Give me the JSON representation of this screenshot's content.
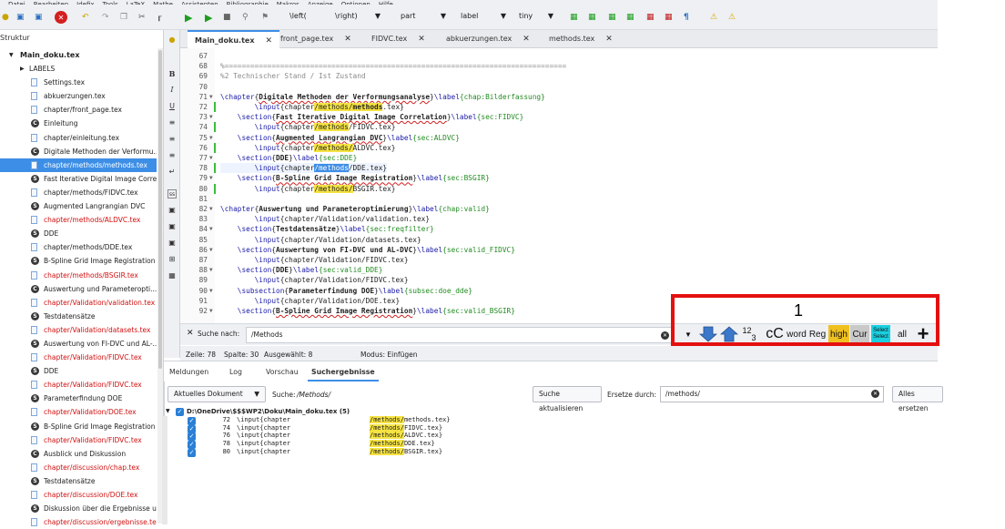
{
  "menu": [
    "Datei",
    "Bearbeiten",
    "Idefix",
    "Tools",
    "LaTeX",
    "Mathe",
    "Assistenten",
    "Bibliographie",
    "Makros",
    "Anzeige",
    "Optionen",
    "Hilfe"
  ],
  "toolbar": {
    "left_delim": "\\left(",
    "right_delim": "\\right)",
    "part": "part",
    "label": "label",
    "size": "tiny"
  },
  "sidebar": {
    "header": "Struktur",
    "items": [
      {
        "label": "Main_doku.tex",
        "type": "root",
        "depth": 0
      },
      {
        "label": "LABELS",
        "type": "folder",
        "depth": 1
      },
      {
        "label": "Settings.tex",
        "type": "file",
        "depth": 2
      },
      {
        "label": "abkuerzungen.tex",
        "type": "file",
        "depth": 2
      },
      {
        "label": "chapter/front_page.tex",
        "type": "file",
        "depth": 2
      },
      {
        "label": "Einleitung",
        "type": "chapter",
        "depth": 2
      },
      {
        "label": "chapter/einleitung.tex",
        "type": "file",
        "depth": 2
      },
      {
        "label": "Digitale Methoden der Verformu...",
        "type": "chapter",
        "depth": 2
      },
      {
        "label": "chapter/methods/methods.tex",
        "type": "file",
        "depth": 2,
        "selected": true
      },
      {
        "label": "Fast Iterative Digital Image Corre...",
        "type": "section",
        "depth": 2
      },
      {
        "label": "chapter/methods/FIDVC.tex",
        "type": "file",
        "depth": 2
      },
      {
        "label": "Augmented Langrangian DVC",
        "type": "section",
        "depth": 2
      },
      {
        "label": "chapter/methods/ALDVC.tex",
        "type": "file",
        "depth": 2,
        "red": true
      },
      {
        "label": "DDE",
        "type": "section",
        "depth": 2,
        "current": true
      },
      {
        "label": "chapter/methods/DDE.tex",
        "type": "file",
        "depth": 2
      },
      {
        "label": "B-Spline Grid Image Registration",
        "type": "section",
        "depth": 2
      },
      {
        "label": "chapter/methods/BSGIR.tex",
        "type": "file",
        "depth": 2,
        "red": true
      },
      {
        "label": "Auswertung und Parameteropti...",
        "type": "chapter",
        "depth": 2
      },
      {
        "label": "chapter/Validation/validation.tex",
        "type": "file",
        "depth": 2,
        "red": true
      },
      {
        "label": "Testdatensätze",
        "type": "section",
        "depth": 2
      },
      {
        "label": "chapter/Validation/datasets.tex",
        "type": "file",
        "depth": 2,
        "red": true
      },
      {
        "label": "Auswertung von FI-DVC und AL-...",
        "type": "section",
        "depth": 2
      },
      {
        "label": "chapter/Validation/FIDVC.tex",
        "type": "file",
        "depth": 2,
        "red": true
      },
      {
        "label": "DDE",
        "type": "section",
        "depth": 2
      },
      {
        "label": "chapter/Validation/FIDVC.tex",
        "type": "file",
        "depth": 2,
        "red": true
      },
      {
        "label": "Parameterfindung DOE",
        "type": "section",
        "depth": 2
      },
      {
        "label": "chapter/Validation/DOE.tex",
        "type": "file",
        "depth": 2,
        "red": true
      },
      {
        "label": "B-Spline Grid Image Registration",
        "type": "section",
        "depth": 2
      },
      {
        "label": "chapter/Validation/FIDVC.tex",
        "type": "file",
        "depth": 2,
        "red": true
      },
      {
        "label": "Ausblick und Diskussion",
        "type": "chapter",
        "depth": 2
      },
      {
        "label": "chapter/discussion/chap.tex",
        "type": "file",
        "depth": 2,
        "red": true
      },
      {
        "label": "Testdatensätze",
        "type": "section",
        "depth": 2
      },
      {
        "label": "chapter/discussion/DOE.tex",
        "type": "file",
        "depth": 2,
        "red": true
      },
      {
        "label": "Diskussion über die Ergebnisse u...",
        "type": "section",
        "depth": 2
      },
      {
        "label": "chapter/discussion/ergebnisse.tex",
        "type": "file",
        "depth": 2,
        "red": true
      }
    ]
  },
  "tabs": [
    {
      "label": "Main_doku.tex",
      "active": true
    },
    {
      "label": "front_page.tex"
    },
    {
      "label": "FIDVC.tex"
    },
    {
      "label": "abkuerzungen.tex"
    },
    {
      "label": "methods.tex"
    }
  ],
  "editor": {
    "lines": [
      {
        "n": "67",
        "segs": []
      },
      {
        "n": "68",
        "segs": [
          {
            "t": "%================================================================================",
            "c": "cmt"
          }
        ]
      },
      {
        "n": "69",
        "segs": [
          {
            "t": "%2 Technischer Stand / Ist Zustand",
            "c": "cmt"
          }
        ]
      },
      {
        "n": "70",
        "segs": []
      },
      {
        "n": "71",
        "fold": true,
        "segs": [
          {
            "t": "\\chapter",
            "c": "cmd"
          },
          {
            "t": "{",
            "c": ""
          },
          {
            "t": "Digitale Methoden der Verformungsanalyse",
            "c": "bold squig"
          },
          {
            "t": "}",
            "c": ""
          },
          {
            "t": "\\label",
            "c": "cmd"
          },
          {
            "t": "{chap:Bilderfassung}",
            "c": "arg"
          }
        ]
      },
      {
        "n": "72",
        "chg": true,
        "segs": [
          {
            "t": "        ",
            "c": ""
          },
          {
            "t": "\\input",
            "c": "cmd"
          },
          {
            "t": "{chapter",
            "c": ""
          },
          {
            "t": "/methods/",
            "c": "hl"
          },
          {
            "t": "methods",
            "c": "hl bold"
          },
          {
            "t": ".tex}",
            "c": ""
          }
        ]
      },
      {
        "n": "73",
        "fold": true,
        "segs": [
          {
            "t": "    ",
            "c": ""
          },
          {
            "t": "\\section",
            "c": "cmd"
          },
          {
            "t": "{",
            "c": ""
          },
          {
            "t": "Fast Iterative Digital Image Correlation",
            "c": "bold squig"
          },
          {
            "t": "}",
            "c": ""
          },
          {
            "t": "\\label",
            "c": "cmd"
          },
          {
            "t": "{sec:FIDVC}",
            "c": "arg"
          }
        ]
      },
      {
        "n": "74",
        "chg": true,
        "segs": [
          {
            "t": "        ",
            "c": ""
          },
          {
            "t": "\\input",
            "c": "cmd"
          },
          {
            "t": "{chapter",
            "c": ""
          },
          {
            "t": "/methods",
            "c": "hl"
          },
          {
            "t": "/FIDVC.tex}",
            "c": ""
          }
        ]
      },
      {
        "n": "75",
        "fold": true,
        "segs": [
          {
            "t": "    ",
            "c": ""
          },
          {
            "t": "\\section",
            "c": "cmd"
          },
          {
            "t": "{",
            "c": ""
          },
          {
            "t": "Augmented Langrangian DVC",
            "c": "bold squig"
          },
          {
            "t": "}",
            "c": ""
          },
          {
            "t": "\\label",
            "c": "cmd"
          },
          {
            "t": "{sec:ALDVC}",
            "c": "arg"
          }
        ]
      },
      {
        "n": "76",
        "chg": true,
        "segs": [
          {
            "t": "        ",
            "c": ""
          },
          {
            "t": "\\input",
            "c": "cmd"
          },
          {
            "t": "{chapter",
            "c": ""
          },
          {
            "t": "/methods/",
            "c": "hl"
          },
          {
            "t": "ALDVC.tex}",
            "c": ""
          }
        ]
      },
      {
        "n": "77",
        "fold": true,
        "segs": [
          {
            "t": "    ",
            "c": ""
          },
          {
            "t": "\\section",
            "c": "cmd"
          },
          {
            "t": "{",
            "c": ""
          },
          {
            "t": "DDE",
            "c": "bold"
          },
          {
            "t": "}",
            "c": ""
          },
          {
            "t": "\\label",
            "c": "cmd"
          },
          {
            "t": "{sec:DDE}",
            "c": "arg"
          }
        ]
      },
      {
        "n": "78",
        "chg": true,
        "cur": true,
        "segs": [
          {
            "t": "        ",
            "c": ""
          },
          {
            "t": "\\input",
            "c": "cmd"
          },
          {
            "t": "{chapter",
            "c": ""
          },
          {
            "t": "/methods",
            "c": "hlsel"
          },
          {
            "t": "/DDE.tex}",
            "c": ""
          }
        ]
      },
      {
        "n": "79",
        "fold": true,
        "segs": [
          {
            "t": "    ",
            "c": ""
          },
          {
            "t": "\\section",
            "c": "cmd"
          },
          {
            "t": "{",
            "c": ""
          },
          {
            "t": "B-Spline Grid Image Registration",
            "c": "bold squig"
          },
          {
            "t": "}",
            "c": ""
          },
          {
            "t": "\\label",
            "c": "cmd"
          },
          {
            "t": "{sec:BSGIR}",
            "c": "arg"
          }
        ]
      },
      {
        "n": "80",
        "chg": true,
        "segs": [
          {
            "t": "        ",
            "c": ""
          },
          {
            "t": "\\input",
            "c": "cmd"
          },
          {
            "t": "{chapter",
            "c": ""
          },
          {
            "t": "/methods/",
            "c": "hl"
          },
          {
            "t": "BSGIR.tex}",
            "c": ""
          }
        ]
      },
      {
        "n": "81",
        "segs": []
      },
      {
        "n": "82",
        "fold": true,
        "segs": [
          {
            "t": "\\chapter",
            "c": "cmd"
          },
          {
            "t": "{",
            "c": ""
          },
          {
            "t": "Auswertung und Parameteroptimierung",
            "c": "bold"
          },
          {
            "t": "}",
            "c": ""
          },
          {
            "t": "\\label",
            "c": "cmd"
          },
          {
            "t": "{chap:valid}",
            "c": "arg"
          }
        ]
      },
      {
        "n": "83",
        "segs": [
          {
            "t": "        ",
            "c": ""
          },
          {
            "t": "\\input",
            "c": "cmd"
          },
          {
            "t": "{chapter/Validation/validation.tex}",
            "c": ""
          }
        ]
      },
      {
        "n": "84",
        "fold": true,
        "segs": [
          {
            "t": "    ",
            "c": ""
          },
          {
            "t": "\\section",
            "c": "cmd"
          },
          {
            "t": "{",
            "c": ""
          },
          {
            "t": "Testdatensätze",
            "c": "bold"
          },
          {
            "t": "}",
            "c": ""
          },
          {
            "t": "\\label",
            "c": "cmd"
          },
          {
            "t": "{sec:freqfilter}",
            "c": "arg"
          }
        ]
      },
      {
        "n": "85",
        "segs": [
          {
            "t": "        ",
            "c": ""
          },
          {
            "t": "\\input",
            "c": "cmd"
          },
          {
            "t": "{chapter/Validation/datasets.tex}",
            "c": ""
          }
        ]
      },
      {
        "n": "86",
        "fold": true,
        "segs": [
          {
            "t": "    ",
            "c": ""
          },
          {
            "t": "\\section",
            "c": "cmd"
          },
          {
            "t": "{",
            "c": ""
          },
          {
            "t": "Auswertung von FI-DVC und AL-DVC",
            "c": "bold"
          },
          {
            "t": "}",
            "c": ""
          },
          {
            "t": "\\label",
            "c": "cmd"
          },
          {
            "t": "{sec:valid_FIDVC}",
            "c": "arg"
          }
        ]
      },
      {
        "n": "87",
        "segs": [
          {
            "t": "        ",
            "c": ""
          },
          {
            "t": "\\input",
            "c": "cmd"
          },
          {
            "t": "{chapter/Validation/FIDVC.tex}",
            "c": ""
          }
        ]
      },
      {
        "n": "88",
        "fold": true,
        "segs": [
          {
            "t": "    ",
            "c": ""
          },
          {
            "t": "\\section",
            "c": "cmd"
          },
          {
            "t": "{",
            "c": ""
          },
          {
            "t": "DDE",
            "c": "bold"
          },
          {
            "t": "}",
            "c": ""
          },
          {
            "t": "\\label",
            "c": "cmd"
          },
          {
            "t": "{sec:valid_DDE}",
            "c": "arg"
          }
        ]
      },
      {
        "n": "89",
        "segs": [
          {
            "t": "        ",
            "c": ""
          },
          {
            "t": "\\input",
            "c": "cmd"
          },
          {
            "t": "{chapter/Validation/FIDVC.tex}",
            "c": ""
          }
        ]
      },
      {
        "n": "90",
        "fold": true,
        "segs": [
          {
            "t": "    ",
            "c": ""
          },
          {
            "t": "\\subsection",
            "c": "cmd"
          },
          {
            "t": "{",
            "c": ""
          },
          {
            "t": "Parameterfindung DOE",
            "c": "bold"
          },
          {
            "t": "}",
            "c": ""
          },
          {
            "t": "\\label",
            "c": "cmd"
          },
          {
            "t": "{subsec:doe_dde}",
            "c": "arg"
          }
        ]
      },
      {
        "n": "91",
        "segs": [
          {
            "t": "        ",
            "c": ""
          },
          {
            "t": "\\input",
            "c": "cmd"
          },
          {
            "t": "{chapter/Validation/DOE.tex}",
            "c": ""
          }
        ]
      },
      {
        "n": "92",
        "fold": true,
        "segs": [
          {
            "t": "    ",
            "c": ""
          },
          {
            "t": "\\section",
            "c": "cmd"
          },
          {
            "t": "{",
            "c": ""
          },
          {
            "t": "B-Spline Grid Image Registration",
            "c": "bold squig"
          },
          {
            "t": "}",
            "c": ""
          },
          {
            "t": "\\label",
            "c": "cmd"
          },
          {
            "t": "{sec:valid_BSGIR}",
            "c": "arg"
          }
        ]
      }
    ]
  },
  "find": {
    "label": "Suche nach:",
    "value": "/Methods",
    "buttons": [
      "cC",
      "word",
      "Reg",
      "high",
      "Cur",
      "Select",
      "all"
    ],
    "select_btn_line2": "Select",
    "superscript": "1",
    "subscript_a": "2",
    "subscript_b": "3"
  },
  "status": {
    "line": "Zeile: 78",
    "col": "Spalte: 30",
    "sel": "Ausgewählt: 8",
    "mode": "Modus: Einfügen"
  },
  "bottom": {
    "tabs": [
      "Meldungen",
      "Log",
      "Vorschau",
      "Suchergebnisse"
    ],
    "scope": "Aktuelles Dokument",
    "search_label": "Suche:",
    "search_value": "/Methods/",
    "refresh": "Suche aktualisieren",
    "replace_label": "Ersetze durch:",
    "replace_value": "/methods/",
    "replace_all": "Alles ersetzen",
    "file": "D:\\OneDrive\\$$$WP2\\Doku\\Main_doku.tex (5)",
    "results": [
      {
        "line": "72",
        "pre": "\\input{chapter",
        "match": "/methods/",
        "post": "methods.tex}"
      },
      {
        "line": "74",
        "pre": "\\input{chapter",
        "match": "/methods/",
        "post": "FIDVC.tex}"
      },
      {
        "line": "76",
        "pre": "\\input{chapter",
        "match": "/methods/",
        "post": "ALDVC.tex}"
      },
      {
        "line": "78",
        "pre": "\\input{chapter",
        "match": "/methods/",
        "post": "DDE.tex}"
      },
      {
        "line": "80",
        "pre": "\\input{chapter",
        "match": "/methods/",
        "post": "BSGIR.tex}"
      }
    ]
  },
  "annotation": {
    "label": "1",
    "color": "#e41010"
  }
}
